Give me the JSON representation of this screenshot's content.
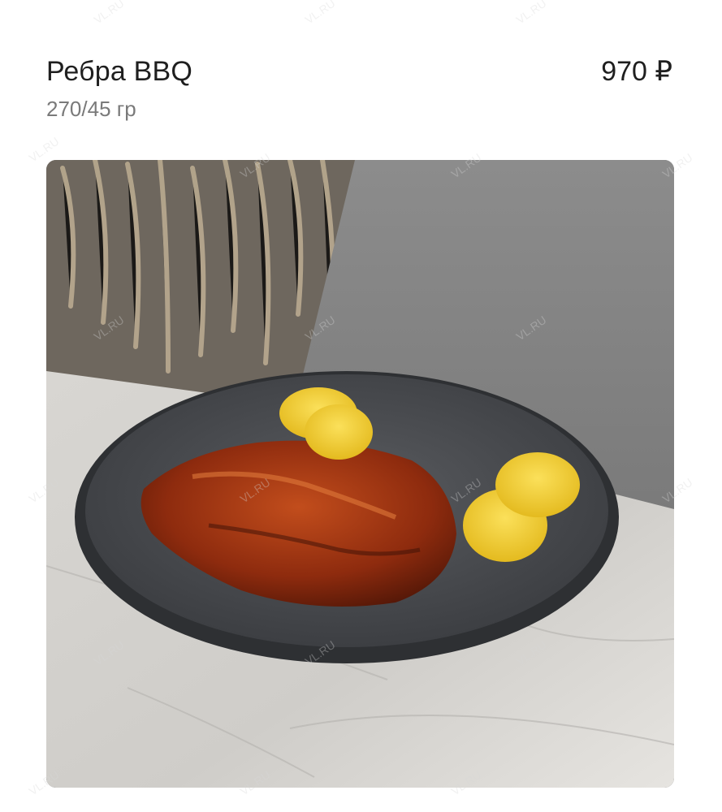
{
  "product": {
    "name": "Ребра BBQ",
    "weight": "270/45 гр",
    "price": "970 ₽"
  },
  "image": {
    "subject": "product-photo"
  },
  "watermark": {
    "text": "VL.RU"
  }
}
